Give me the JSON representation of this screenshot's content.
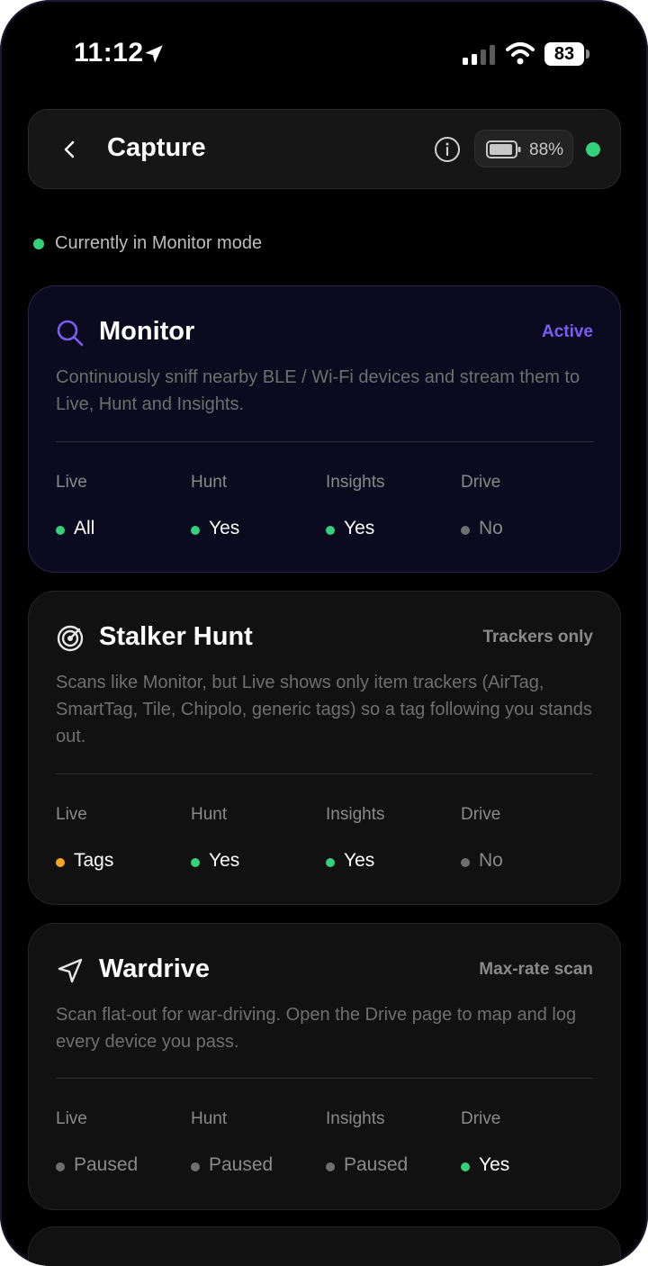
{
  "status_bar": {
    "time": "11:12",
    "battery_level": "83",
    "icons": [
      "location-arrow-icon",
      "cellular-signal-icon",
      "wifi-icon",
      "battery-icon"
    ]
  },
  "header": {
    "title": "Capture",
    "battery_pct": "88%",
    "connection_status_color": "#33d17a",
    "icons": [
      "chevron-left-icon",
      "info-icon",
      "battery-icon"
    ]
  },
  "mode_line": {
    "text": "Currently in Monitor mode"
  },
  "colors": {
    "accent": "#7b5cf5",
    "on": "#33d17a",
    "warn": "#f5a623",
    "off": "#6f6f6f"
  },
  "cards": [
    {
      "title": "Monitor",
      "badge": "Active",
      "icon": "search-icon",
      "desc": "Continuously sniff nearby BLE / Wi-Fi devices and stream them to Live, Hunt and Insights.",
      "stats": [
        {
          "label": "Live",
          "value": "All",
          "state": "on"
        },
        {
          "label": "Hunt",
          "value": "Yes",
          "state": "on"
        },
        {
          "label": "Insights",
          "value": "Yes",
          "state": "on"
        },
        {
          "label": "Drive",
          "value": "No",
          "state": "off"
        }
      ]
    },
    {
      "title": "Stalker Hunt",
      "badge": "Trackers only",
      "icon": "radar-icon",
      "desc": "Scans like Monitor, but Live shows only item trackers (AirTag, SmartTag, Tile, Chipolo, generic tags) so a tag following you stands out.",
      "stats": [
        {
          "label": "Live",
          "value": "Tags",
          "state": "warn"
        },
        {
          "label": "Hunt",
          "value": "Yes",
          "state": "on"
        },
        {
          "label": "Insights",
          "value": "Yes",
          "state": "on"
        },
        {
          "label": "Drive",
          "value": "No",
          "state": "off"
        }
      ]
    },
    {
      "title": "Wardrive",
      "badge": "Max-rate scan",
      "icon": "navigation-arrow-icon",
      "desc": "Scan flat-out for war-driving. Open the Drive page to map and log every device you pass.",
      "stats": [
        {
          "label": "Live",
          "value": "Paused",
          "state": "off"
        },
        {
          "label": "Hunt",
          "value": "Paused",
          "state": "off"
        },
        {
          "label": "Insights",
          "value": "Paused",
          "state": "off"
        },
        {
          "label": "Drive",
          "value": "Yes",
          "state": "on"
        }
      ]
    }
  ]
}
